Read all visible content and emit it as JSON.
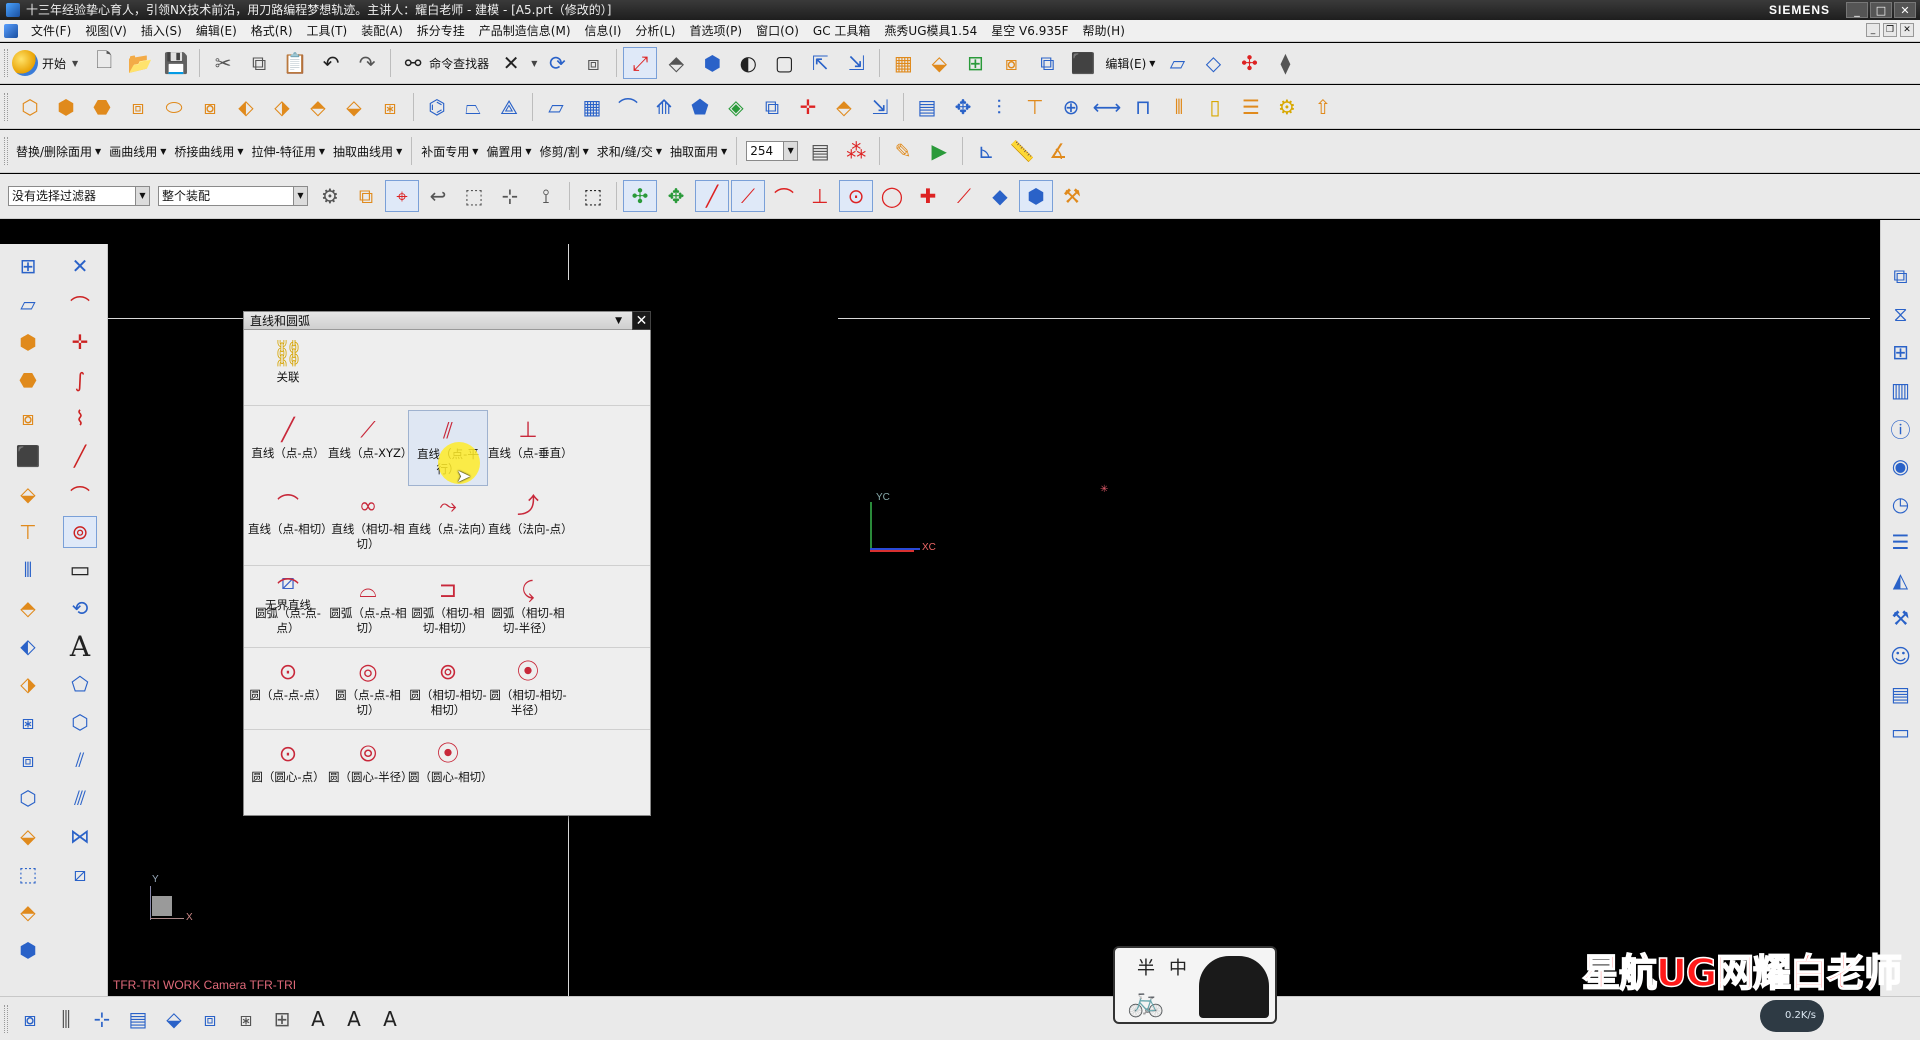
{
  "window": {
    "title": "十三年经验挚心育人，引领NX技术前沿，用刀路编程梦想轨迹。主讲人：耀白老师 - 建模 - [A5.prt（修改的）]",
    "brand": "SIEMENS",
    "buttons": [
      "_",
      "□",
      "✕"
    ]
  },
  "menubar": {
    "items": [
      "文件(F)",
      "视图(V)",
      "插入(S)",
      "编辑(E)",
      "格式(R)",
      "工具(T)",
      "装配(A)",
      "拆分专挂",
      "产品制造信息(M)",
      "信息(I)",
      "分析(L)",
      "首选项(P)",
      "窗口(O)",
      "GC 工具箱",
      "燕秀UG模具1.54",
      "星空 V6.935F",
      "帮助(H)"
    ]
  },
  "toolbar1": {
    "start_label": "开始",
    "cmd_finder_label": "命令查找器",
    "edit_menu_label": "编辑(E)"
  },
  "toolbar3": {
    "menus": [
      "替换/删除面用",
      "画曲线用",
      "桥接曲线用",
      "拉伸-特征用",
      "抽取曲线用",
      "补面专用",
      "偏置用",
      "修剪/割",
      "求和/缝/交",
      "抽取面用"
    ],
    "layer_value": "254"
  },
  "toolbar4": {
    "filter_value": "没有选择过滤器",
    "assembly_value": "整个装配"
  },
  "dialog": {
    "title": "直线和圆弧",
    "associative_label": "关联",
    "lines": [
      {
        "label": "直线（点-点）",
        "icon": "line-point-point-icon"
      },
      {
        "label": "直线（点-XYZ）",
        "icon": "line-point-xyz-icon"
      },
      {
        "label": "直线（点-平行）",
        "icon": "line-point-parallel-icon"
      },
      {
        "label": "直线（点-垂直）",
        "icon": "line-point-perpendicular-icon"
      },
      {
        "label": "直线（点-相切）",
        "icon": "line-point-tangent-icon"
      },
      {
        "label": "直线（相切-相切）",
        "icon": "line-tangent-tangent-icon"
      },
      {
        "label": "直线（点-法向）",
        "icon": "line-point-normal-icon"
      },
      {
        "label": "直线（法向-点）",
        "icon": "line-normal-point-icon"
      },
      {
        "label": "无界直线",
        "icon": "infinite-line-icon"
      }
    ],
    "arcs": [
      {
        "label": "圆弧（点-点-点）",
        "icon": "arc-3point-icon"
      },
      {
        "label": "圆弧（点-点-相切）",
        "icon": "arc-point-point-tangent-icon"
      },
      {
        "label": "圆弧（相切-相切-相切）",
        "icon": "arc-3tangent-icon"
      },
      {
        "label": "圆弧（相切-相切-半径）",
        "icon": "arc-tangent-tangent-radius-icon"
      }
    ],
    "circles": [
      {
        "label": "圆（点-点-点）",
        "icon": "circle-3point-icon"
      },
      {
        "label": "圆（点-点-相切）",
        "icon": "circle-point-point-tangent-icon"
      },
      {
        "label": "圆（相切-相切-相切）",
        "icon": "circle-3tangent-icon"
      },
      {
        "label": "圆（相切-相切-半径）",
        "icon": "circle-tangent-tangent-radius-icon"
      }
    ],
    "centers": [
      {
        "label": "圆（圆心-点）",
        "icon": "circle-center-point-icon"
      },
      {
        "label": "圆（圆心-半径）",
        "icon": "circle-center-radius-icon"
      },
      {
        "label": "圆（圆心-相切）",
        "icon": "circle-center-tangent-icon"
      }
    ]
  },
  "graphics": {
    "status_text": "TFR-TRI WORK Camera TFR-TRI",
    "wcs_y_label": "YC",
    "wcs_x_label": "XC",
    "abs_y_label": "Y",
    "abs_x_label": "X"
  },
  "overlay": {
    "watermark": "星航UG网耀白老师",
    "logo_text": "半中",
    "speed_text": "0.2K/s"
  },
  "colors": {
    "graphics_bg": "#000000",
    "watermark": "#ff1a1a",
    "highlight": "#ffeb28"
  }
}
